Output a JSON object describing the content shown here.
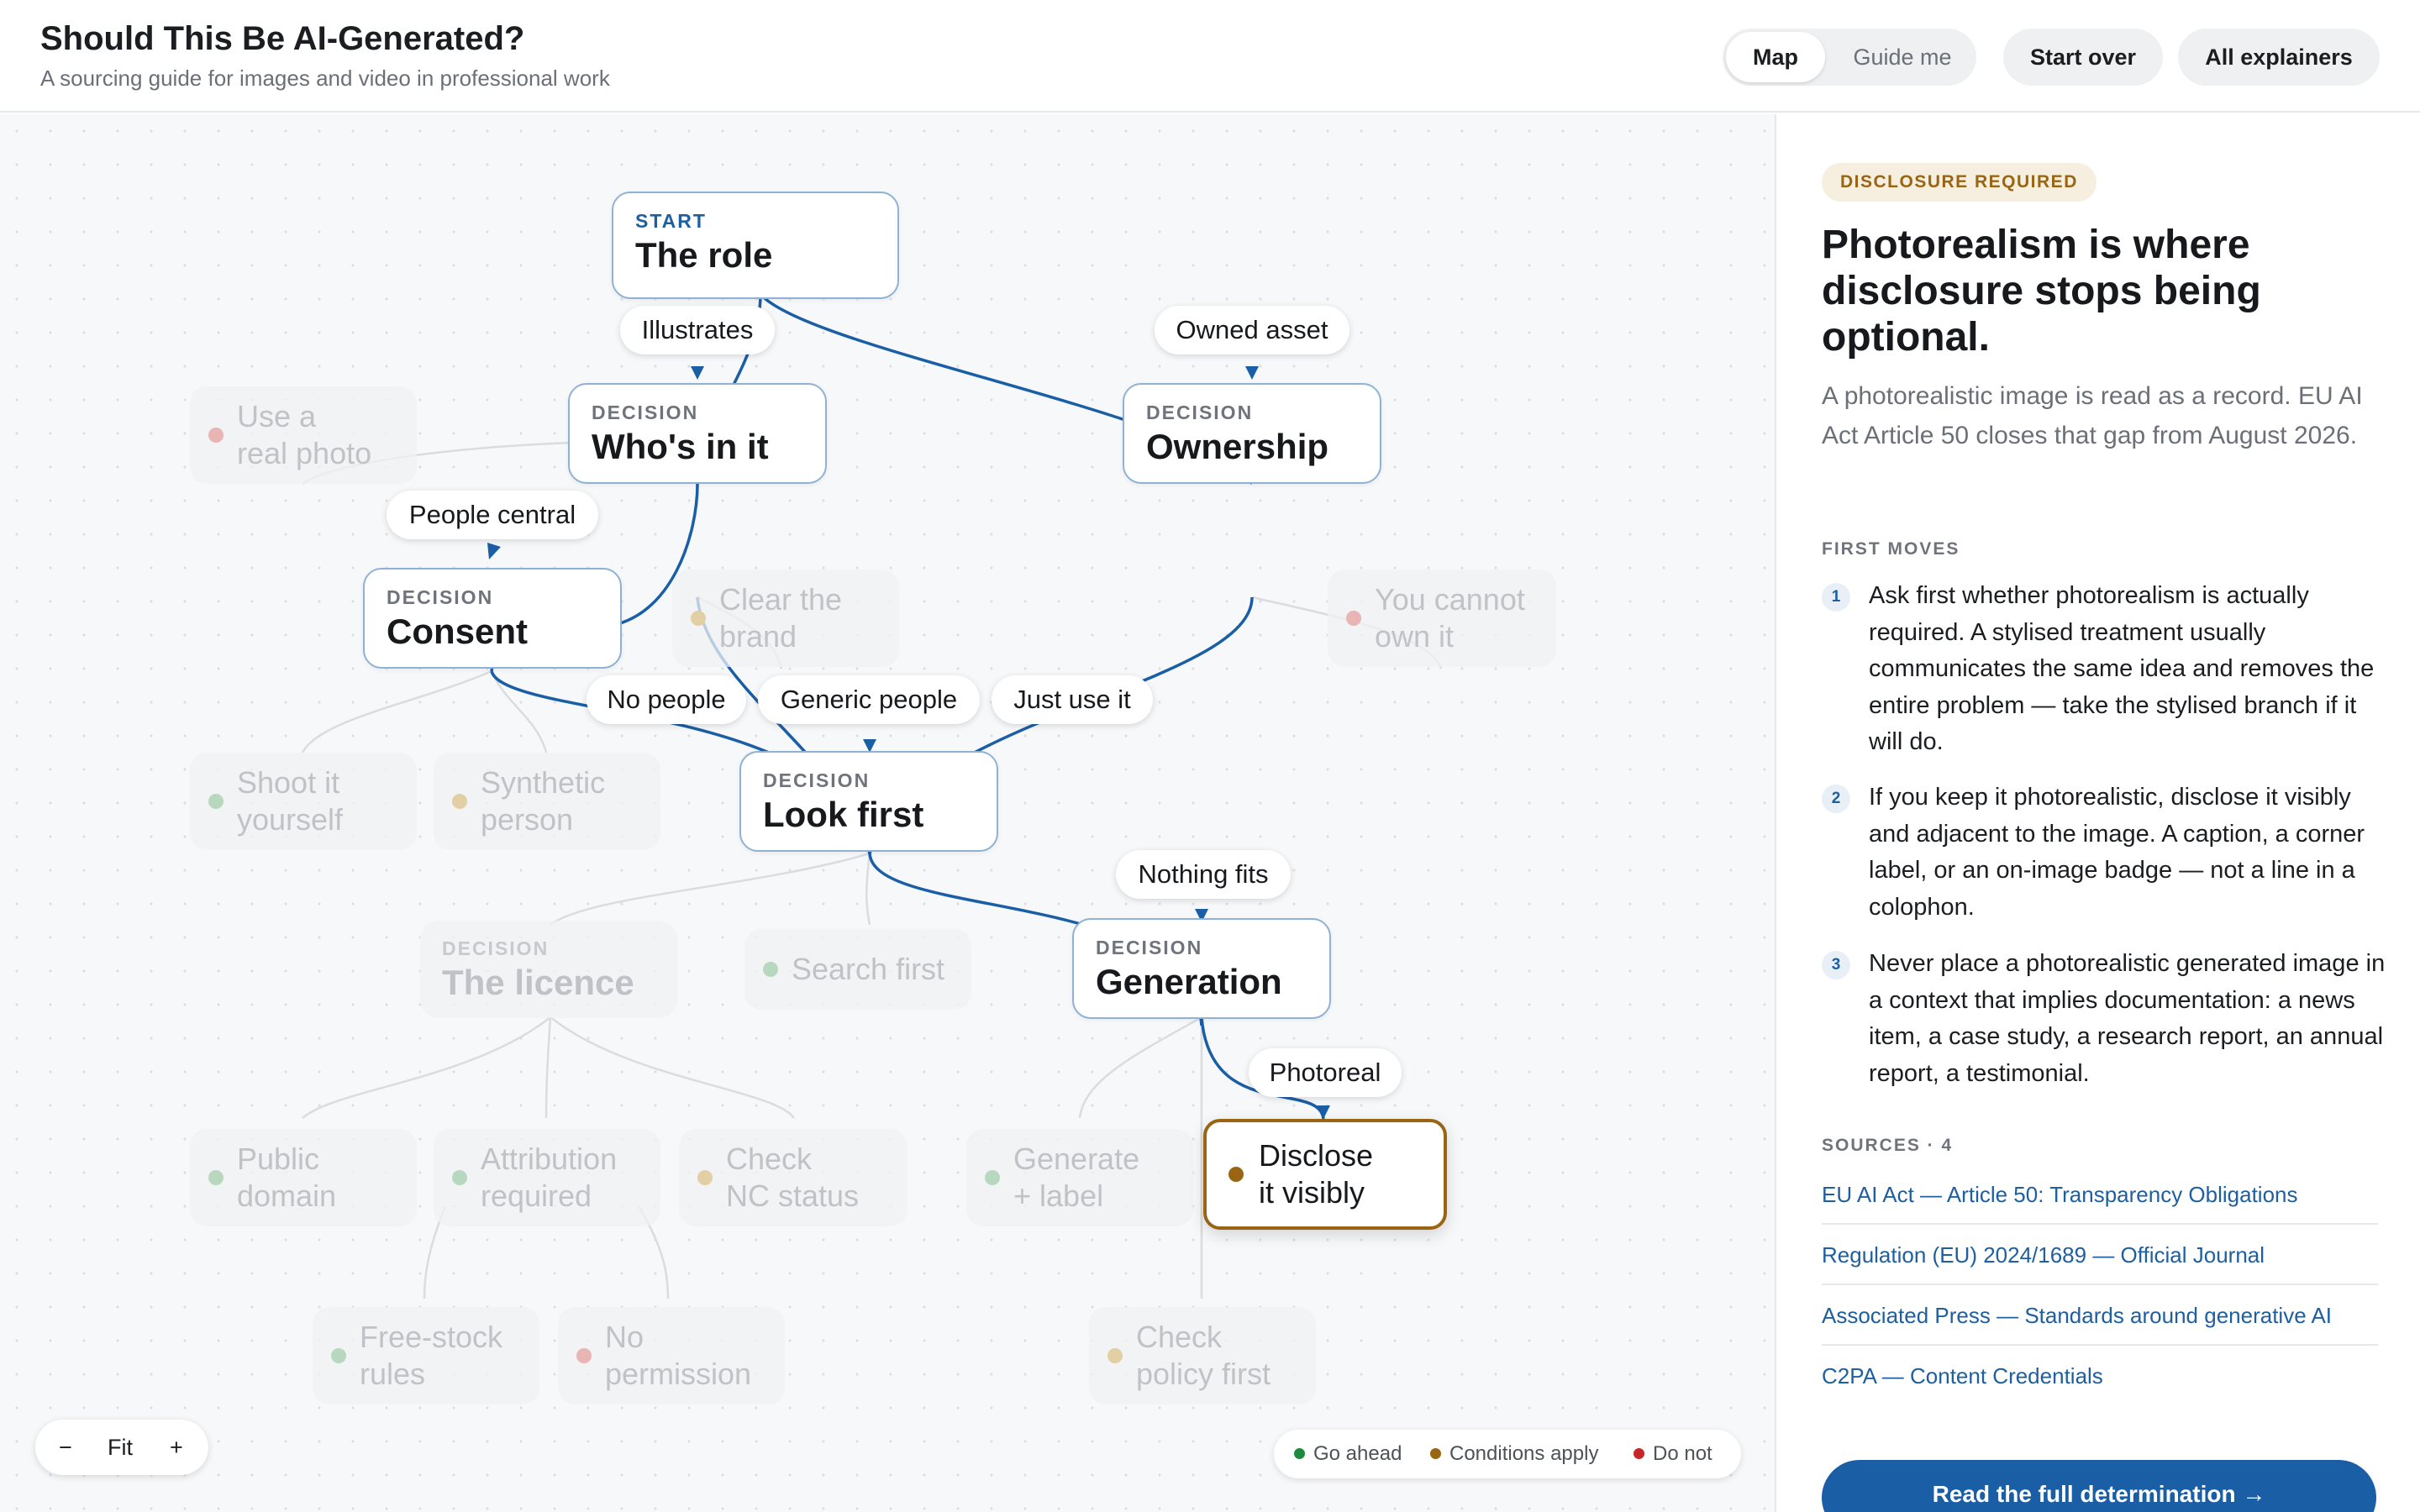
{
  "header": {
    "title": "Should This Be AI-Generated?",
    "subtitle": "A sourcing guide for images and video in professional work",
    "view_toggle": {
      "map": "Map",
      "guide": "Guide me",
      "active": "Map"
    },
    "start_over": "Start over",
    "all_explainers": "All explainers"
  },
  "map": {
    "nodes": {
      "role": {
        "kicker": "START",
        "title": "The role"
      },
      "whos_in_it": {
        "kicker": "DECISION",
        "title": "Who's in it"
      },
      "ownership": {
        "kicker": "DECISION",
        "title": "Ownership"
      },
      "consent": {
        "kicker": "DECISION",
        "title": "Consent"
      },
      "look_first": {
        "kicker": "DECISION",
        "title": "Look first"
      },
      "licence": {
        "kicker": "DECISION",
        "title": "The licence"
      },
      "generation": {
        "kicker": "DECISION",
        "title": "Generation"
      }
    },
    "leaves": {
      "real_photo": {
        "line1": "Use a",
        "line2": "real photo",
        "status": "no"
      },
      "clear_brand": {
        "line1": "Clear the",
        "line2": "brand",
        "status": "conditions"
      },
      "cannot_own": {
        "line1": "You cannot",
        "line2": "own it",
        "status": "no"
      },
      "shoot_yourself": {
        "line1": "Shoot it",
        "line2": "yourself",
        "status": "go"
      },
      "synthetic_person": {
        "line1": "Synthetic",
        "line2": "person",
        "status": "conditions"
      },
      "search_first": {
        "line1": "Search first",
        "status": "go"
      },
      "public_domain": {
        "line1": "Public",
        "line2": "domain",
        "status": "go"
      },
      "attribution": {
        "line1": "Attribution",
        "line2": "required",
        "status": "go"
      },
      "nc_status": {
        "line1": "Check",
        "line2": "NC status",
        "status": "conditions"
      },
      "generate_label": {
        "line1": "Generate",
        "line2": "+ label",
        "status": "go"
      },
      "disclose": {
        "line1": "Disclose",
        "line2": "it visibly",
        "status": "conditions"
      },
      "free_stock": {
        "line1": "Free-stock",
        "line2": "rules",
        "status": "go"
      },
      "no_permission": {
        "line1": "No",
        "line2": "permission",
        "status": "no"
      },
      "policy_first": {
        "line1": "Check",
        "line2": "policy first",
        "status": "conditions"
      }
    },
    "edge_labels": {
      "illustrates": "Illustrates",
      "owned_asset": "Owned asset",
      "people_central": "People central",
      "no_people": "No people",
      "generic_people": "Generic people",
      "just_use_it": "Just use it",
      "nothing_fits": "Nothing fits",
      "photoreal": "Photoreal"
    },
    "zoom": {
      "minus": "−",
      "fit": "Fit",
      "plus": "+"
    },
    "legend": {
      "go": "Go ahead",
      "conditions": "Conditions apply",
      "no": "Do not"
    },
    "colors": {
      "go": "#1e8a3e",
      "conditions": "#9a6512",
      "no": "#c62828",
      "path": "#1a5ea6"
    }
  },
  "panel": {
    "badge": "DISCLOSURE REQUIRED",
    "title": "Photorealism is where disclosure stops being optional.",
    "description": "A photorealistic image is read as a record. EU AI Act Article 50 closes that gap from August 2026.",
    "first_moves_label": "FIRST MOVES",
    "moves": [
      {
        "num": "1",
        "text": "Ask first whether photorealism is actually required. A stylised treatment usually communicates the same idea and removes the entire problem — take the stylised branch if it will do."
      },
      {
        "num": "2",
        "text": "If you keep it photorealistic, disclose it visibly and adjacent to the image. A caption, a corner label, or an on-image badge — not a line in a colophon."
      },
      {
        "num": "3",
        "text": "Never place a photorealistic generated image in a context that implies documentation: a news item, a case study, a research report, an annual report, a testimonial."
      }
    ],
    "sources_label": "SOURCES · 4",
    "sources": [
      "EU AI Act — Article 50: Transparency Obligations",
      "Regulation (EU) 2024/1689 — Official Journal",
      "Associated Press — Standards around generative AI",
      "C2PA — Content Credentials"
    ],
    "cta": "Read the full determination →"
  }
}
